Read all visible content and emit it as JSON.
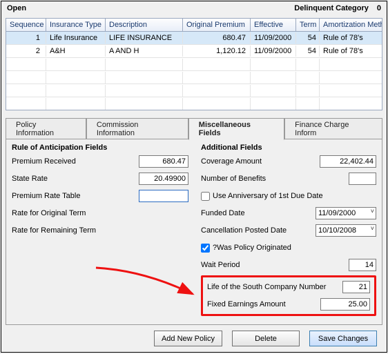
{
  "header": {
    "status": "Open",
    "delinquent_label": "Delinquent Category",
    "delinquent_value": "0"
  },
  "grid": {
    "headers": {
      "sequence": "Sequence",
      "insurance_type": "Insurance Type",
      "description": "Description",
      "original_premium": "Original Premium",
      "effective": "Effective",
      "term": "Term",
      "amortization": "Amortization Method"
    },
    "rows": [
      {
        "sequence": "1",
        "insurance_type": "Life Insurance",
        "description": "LIFE INSURANCE",
        "original_premium": "680.47",
        "effective": "11/09/2000",
        "term": "54",
        "amortization": "Rule of 78's",
        "selected": true
      },
      {
        "sequence": "2",
        "insurance_type": "A&H",
        "description": "A AND H",
        "original_premium": "1,120.12",
        "effective": "11/09/2000",
        "term": "54",
        "amortization": "Rule of 78's",
        "selected": false
      }
    ]
  },
  "tabs": {
    "t1": "Policy Information",
    "t2": "Commission Information",
    "t3": "Miscellaneous Fields",
    "t4": "Finance Charge Inform"
  },
  "left": {
    "title": "Rule of Anticipation Fields",
    "premium_received_label": "Premium Received",
    "premium_received_value": "680.47",
    "state_rate_label": "State Rate",
    "state_rate_value": "20.49900",
    "premium_rate_table_label": "Premium Rate Table",
    "premium_rate_table_value": "",
    "rate_original_label": "Rate for Original Term",
    "rate_remaining_label": "Rate for Remaining Term"
  },
  "right": {
    "title": "Additional Fields",
    "coverage_label": "Coverage Amount",
    "coverage_value": "22,402.44",
    "benefits_label": "Number of Benefits",
    "benefits_value": "",
    "anniv_label": "Use Anniversary of 1st Due Date",
    "funded_label": "Funded Date",
    "funded_value": "11/09/2000",
    "cancel_label": "Cancellation Posted Date",
    "cancel_value": "10/10/2008",
    "originated_label": "?Was Policy Originated",
    "wait_label": "Wait Period",
    "wait_value": "14",
    "los_label": "Life of the South Company Number",
    "los_value": "21",
    "fixed_label": "Fixed Earnings Amount",
    "fixed_value": "25.00"
  },
  "buttons": {
    "add": "Add New Policy",
    "delete": "Delete",
    "save": "Save Changes"
  }
}
